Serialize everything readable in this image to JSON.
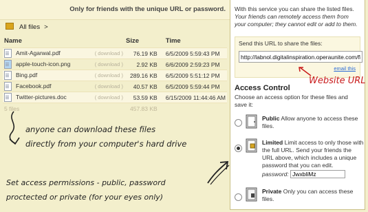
{
  "header": {
    "notice": "Only for friends with the unique URL or password."
  },
  "breadcrumb": {
    "label": "All files",
    "sep": ">"
  },
  "table": {
    "columns": [
      "Name",
      "Size",
      "Time"
    ],
    "rows": [
      {
        "name": "Amit-Agarwal.pdf",
        "icon": "document-icon",
        "download": "( download )",
        "size": "76.19 KB",
        "time": "6/5/2009  5:59:43 PM"
      },
      {
        "name": "apple-touch-icon.png",
        "icon": "image-icon",
        "download": "( download )",
        "size": "2.92 KB",
        "time": "6/6/2009  2:59:23 PM"
      },
      {
        "name": "Bing.pdf",
        "icon": "document-icon",
        "download": "( download )",
        "size": "289.16 KB",
        "time": "6/5/2009  5:51:12 PM"
      },
      {
        "name": "Facebook.pdf",
        "icon": "document-icon",
        "download": "( download )",
        "size": "40.57 KB",
        "time": "6/5/2009  5:59:44 PM"
      },
      {
        "name": "Twitter-pictures.doc",
        "icon": "document-icon",
        "download": "( download )",
        "size": "53.59 KB",
        "time": "6/15/2009  11:44:46 AM"
      }
    ],
    "total": {
      "label": "5 files",
      "size": "457.83 KB"
    }
  },
  "notes": {
    "line1": "anyone can download these files",
    "line2": "directly from your computer's hard drive",
    "line3": "Set access permissions - public, password",
    "line4": "proctected or private (for your eyes only)",
    "website_url": "Website URL"
  },
  "panel": {
    "intro_plain": "With this service you can share the listed files.",
    "intro_italic": "Your friends can remotely access them from your computer; they cannot edit or add to them.",
    "url_label": "Send this URL to share the files:",
    "url_value": "http://labnol.digitalinspiration.operaunite.com/fi",
    "email_link": "email this",
    "access_title": "Access Control",
    "access_desc": "Choose an access option for these files and save it:",
    "options": [
      {
        "title": "Public",
        "text": "Allow anyone to access these files.",
        "selected": false,
        "icon": "globe-icon"
      },
      {
        "title": "Limited",
        "text": "Limit access to only those with the full URL. Send your friends the URL above, which includes a unique password that you can edit.",
        "selected": true,
        "icon": "lock-icon",
        "password_label": "password:",
        "password_value": "JwxbliMz"
      },
      {
        "title": "Private",
        "text": "Only you can access these files.",
        "selected": false,
        "icon": "padlock-icon"
      }
    ]
  }
}
